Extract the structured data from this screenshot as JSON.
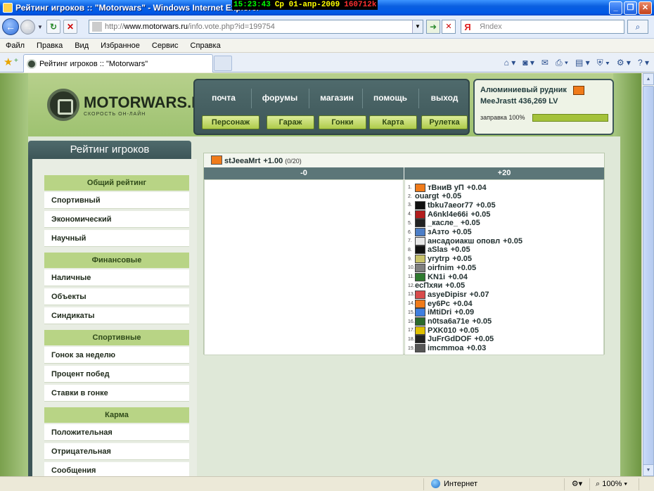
{
  "window": {
    "title": "Рейтинг игроков :: \"Motorwars\" - Windows Internet Explorer",
    "clock_time": "15:23:43",
    "clock_date": "Ср 01-апр-2009",
    "clock_mem": "160712k"
  },
  "address": {
    "url_prefix": "http://",
    "url_domain": "www.motorwars.ru",
    "url_path": "/info.vote.php?id=199754"
  },
  "search": {
    "placeholder": "Яndex",
    "engine_glyph": "Я"
  },
  "menu": [
    "Файл",
    "Правка",
    "Вид",
    "Избранное",
    "Сервис",
    "Справка"
  ],
  "tab": {
    "title": "Рейтинг игроков :: \"Motorwars\""
  },
  "site": {
    "logo_name": "MOTORWARS.RU",
    "logo_sub": "СКОРОСТЬ ОН-ЛАЙН",
    "top_links": [
      "почта",
      "форумы",
      "магазин",
      "помощь",
      "выход"
    ],
    "top_buttons": [
      "Персонаж",
      "Гараж",
      "Гонки",
      "Карта",
      "Рулетка"
    ],
    "resource": {
      "title": "Алюминиевый рудник",
      "user": "MeeJrastt 436,269 LV",
      "fuel_label": "заправка 100%",
      "fuel_percent": 100
    }
  },
  "sidebar": {
    "title": "Рейтинг игроков",
    "sections": [
      {
        "title": "Общий рейтинг",
        "items": [
          "Спортивный",
          "Экономический",
          "Научный"
        ]
      },
      {
        "title": "Финансовые",
        "items": [
          "Наличные",
          "Объекты",
          "Синдикаты"
        ]
      },
      {
        "title": "Спортивные",
        "items": [
          "Гонок за неделю",
          "Процент побед",
          "Ставки в гонке"
        ]
      },
      {
        "title": "Карма",
        "items": [
          "Положительная",
          "Отрицательная",
          "Сообщения"
        ]
      }
    ]
  },
  "main": {
    "player": "stJeeaMrt",
    "score": "+1.00",
    "count": "(0/20)",
    "col_minus": "-0",
    "col_plus": "+20",
    "votes": [
      {
        "n": "1.",
        "name": "тВниВ уП",
        "val": "+0.04",
        "color": "#f07b1a"
      },
      {
        "n": "2.",
        "name": "ouargt",
        "val": "+0.05",
        "color": ""
      },
      {
        "n": "3.",
        "name": "tbku7aeor77",
        "val": "+0.05",
        "color": "#111111"
      },
      {
        "n": "4.",
        "name": "A6nkl4e66i",
        "val": "+0.05",
        "color": "#b31d1d"
      },
      {
        "n": "5.",
        "name": "_касле_",
        "val": "+0.05",
        "color": "#222222"
      },
      {
        "n": "6.",
        "name": "зАзто",
        "val": "+0.05",
        "color": "#4d7ec7"
      },
      {
        "n": "7.",
        "name": "ансадоиакш оповл",
        "val": "+0.05",
        "color": "#e8e8e8"
      },
      {
        "n": "8.",
        "name": "aSlas",
        "val": "+0.05",
        "color": "#111111"
      },
      {
        "n": "9.",
        "name": "yrytrp",
        "val": "+0.05",
        "color": "#c9c36a"
      },
      {
        "n": "10.",
        "name": "oirfnim",
        "val": "+0.05",
        "color": "#7f7f7f"
      },
      {
        "n": "11.",
        "name": "KN1i",
        "val": "+0.04",
        "color": "#2f7a2f"
      },
      {
        "n": "12.",
        "name": "есПхяи",
        "val": "+0.05",
        "color": ""
      },
      {
        "n": "13.",
        "name": "asyeDipisr",
        "val": "+0.07",
        "color": "#d84b4b"
      },
      {
        "n": "14.",
        "name": "ey6Pc",
        "val": "+0.04",
        "color": "#f07b1a"
      },
      {
        "n": "15.",
        "name": "iMtiDri",
        "val": "+0.09",
        "color": "#3f7fe0"
      },
      {
        "n": "16.",
        "name": "n0tsa6a71e",
        "val": "+0.05",
        "color": "#2c6b2c"
      },
      {
        "n": "17.",
        "name": "PXK010",
        "val": "+0.05",
        "color": "#e0c000"
      },
      {
        "n": "18.",
        "name": "JuFrGdDOF",
        "val": "+0.05",
        "color": "#222222"
      },
      {
        "n": "19.",
        "name": "imcmmoa",
        "val": "+0.03",
        "color": "#555555"
      }
    ]
  },
  "status": {
    "zone": "Интернет",
    "zoom": "100%"
  }
}
